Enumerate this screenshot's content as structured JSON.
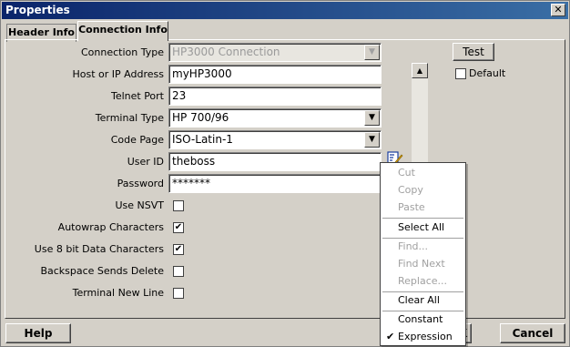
{
  "window": {
    "title": "Properties"
  },
  "tabs": [
    {
      "label": "Header Info"
    },
    {
      "label": "Connection Info"
    }
  ],
  "form": {
    "connection_type_label": "Connection Type",
    "connection_type_value": "HP3000 Connection",
    "host_label": "Host or IP Address",
    "host_value": "myHP3000",
    "telnet_port_label": "Telnet Port",
    "telnet_port_value": "23",
    "terminal_type_label": "Terminal Type",
    "terminal_type_value": "HP 700/96",
    "code_page_label": "Code Page",
    "code_page_value": "ISO-Latin-1",
    "user_id_label": "User ID",
    "user_id_value": "theboss",
    "password_label": "Password",
    "password_value": "*******",
    "use_nsvt_label": "Use NSVT",
    "use_nsvt_checked": false,
    "autowrap_label": "Autowrap Characters",
    "autowrap_checked": true,
    "use8bit_label": "Use 8 bit Data Characters",
    "use8bit_checked": true,
    "backspace_label": "Backspace Sends Delete",
    "backspace_checked": false,
    "terminal_newline_label": "Terminal New Line",
    "terminal_newline_checked": false
  },
  "side": {
    "test_label": "Test",
    "default_label": "Default",
    "default_checked": false
  },
  "footer": {
    "help_label": "Help",
    "ok_label": "K",
    "cancel_label": "Cancel"
  },
  "context_menu": {
    "items": [
      {
        "label": "Cut",
        "enabled": false
      },
      {
        "label": "Copy",
        "enabled": false
      },
      {
        "label": "Paste",
        "enabled": false
      },
      {
        "label": "Select All",
        "enabled": true
      },
      {
        "label": "Find...",
        "enabled": false
      },
      {
        "label": "Find Next",
        "enabled": false
      },
      {
        "label": "Replace...",
        "enabled": false
      },
      {
        "label": "Clear All",
        "enabled": true
      },
      {
        "label": "Constant",
        "enabled": true
      },
      {
        "label": "Expression",
        "enabled": true,
        "checked": true
      }
    ]
  },
  "icons": {
    "check": "✔",
    "dropdown": "▼",
    "scroll_up": "▲",
    "close": "✕"
  },
  "colors": {
    "title_gradient_start": "#0a246a",
    "title_gradient_end": "#3a6ea5",
    "dialog_bg": "#d4d0c8"
  }
}
